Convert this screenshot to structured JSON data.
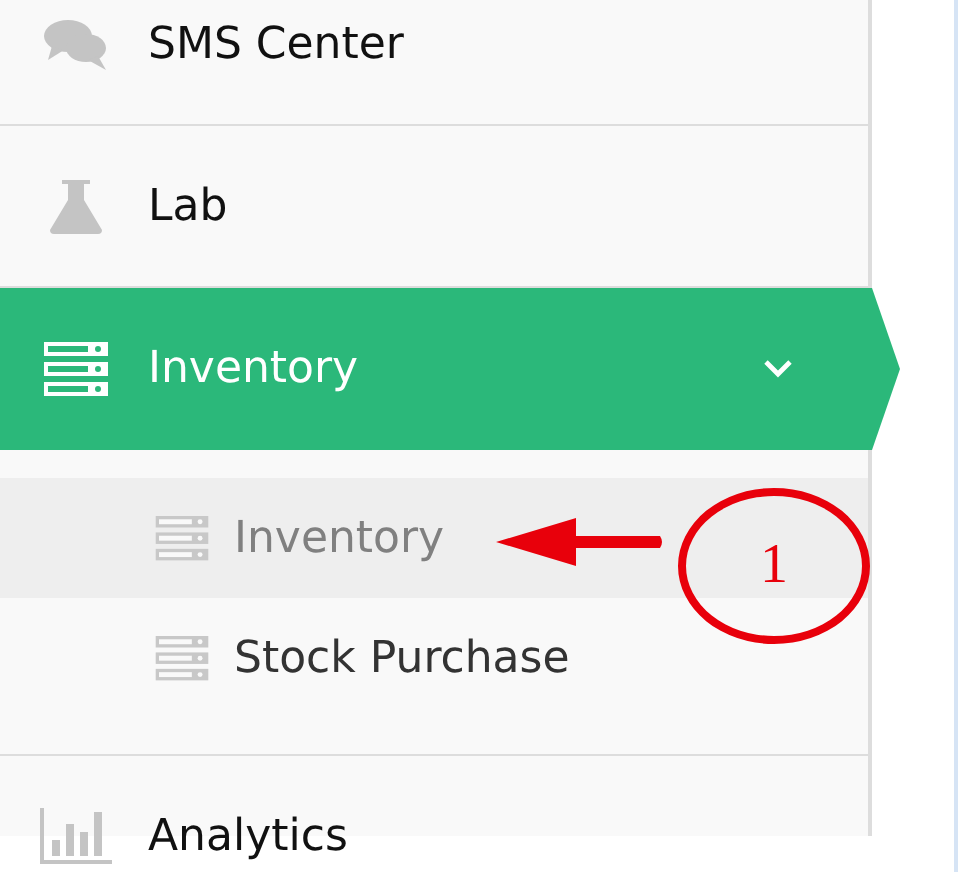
{
  "sidebar": {
    "items": [
      {
        "label": "SMS Center",
        "kind": "chat",
        "selected": false
      },
      {
        "label": "Lab",
        "kind": "flask",
        "selected": false
      },
      {
        "label": "Inventory",
        "kind": "server",
        "selected": true,
        "expanded": true,
        "children": [
          {
            "label": "Inventory",
            "kind": "server",
            "selected": true
          },
          {
            "label": "Stock Purchase",
            "kind": "server",
            "selected": false
          }
        ]
      },
      {
        "label": "Analytics",
        "kind": "chart",
        "selected": false
      }
    ]
  },
  "annotation": {
    "marker": "1"
  }
}
